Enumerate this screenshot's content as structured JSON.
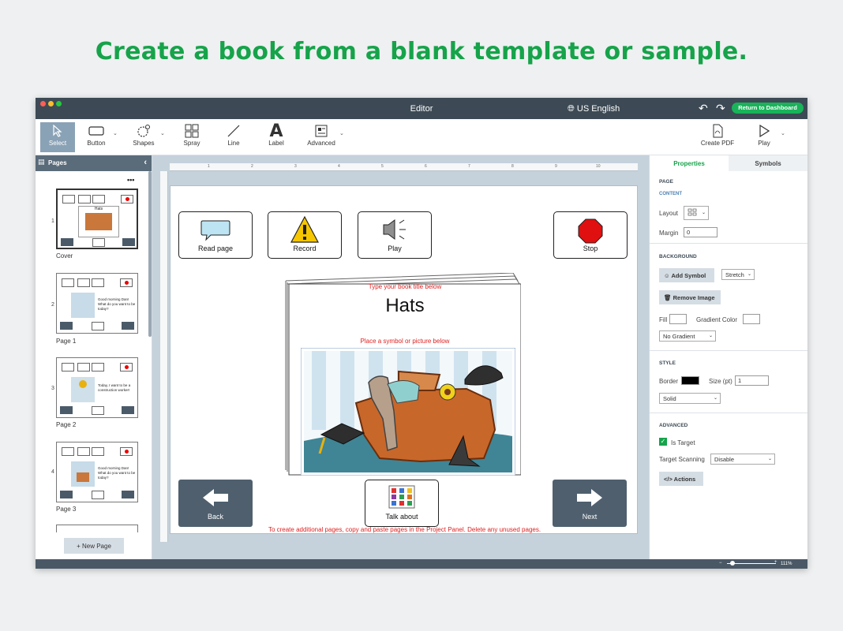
{
  "headline": "Create a book from a blank template or sample.",
  "colors": {
    "accent": "#16a34a",
    "titlebar": "#3d4a55",
    "dash_button": "#19b35a"
  },
  "window": {
    "title": "Editor",
    "language": "US English",
    "return_button": "Return to Dashboard"
  },
  "toolbar": {
    "select": "Select",
    "button": "Button",
    "shapes": "Shapes",
    "spray": "Spray",
    "line": "Line",
    "label": "Label",
    "label_glyph": "A",
    "advanced": "Advanced",
    "create_pdf": "Create PDF",
    "play": "Play"
  },
  "pages_panel": {
    "title": "Pages",
    "menu": "•••",
    "thumbs": [
      {
        "num": "1",
        "label": "Cover",
        "title": "Hats"
      },
      {
        "num": "2",
        "label": "Page 1",
        "text": "Good morning Dan! What do you want to be today?"
      },
      {
        "num": "3",
        "label": "Page 2",
        "text": "Today, I want to be a construction worker!"
      },
      {
        "num": "4",
        "label": "Page 3",
        "text": "Good morning Dan! What do you want to be today?"
      }
    ],
    "new_page": "+ New Page"
  },
  "canvas": {
    "ruler": [
      "1",
      "2",
      "3",
      "4",
      "5",
      "6",
      "7",
      "8",
      "9",
      "10"
    ],
    "buttons": {
      "read_page": "Read page",
      "record": "Record",
      "play": "Play",
      "stop": "Stop",
      "back": "Back",
      "next": "Next",
      "talk_about": "Talk about"
    },
    "book_title_hint": "Type your book title below",
    "book_title": "Hats",
    "picture_hint": "Place a symbol or picture below",
    "bottom_hint": "To create additional pages, copy and paste pages in the Project Panel. Delete any unused pages."
  },
  "properties": {
    "tab_properties": "Properties",
    "tab_symbols": "Symbols",
    "page_title": "PAGE",
    "content_title": "CONTENT",
    "layout_label": "Layout",
    "margin_label": "Margin",
    "margin_value": "0",
    "background_title": "BACKGROUND",
    "add_symbol": "Add Symbol",
    "stretch": "Stretch",
    "remove_image": "Remove Image",
    "fill_label": "Fill",
    "gradient_color_label": "Gradient Color",
    "gradient_select": "No Gradient",
    "style_title": "STYLE",
    "border_label": "Border",
    "size_label": "Size (pt)",
    "size_value": "1",
    "line_style": "Solid",
    "advanced_title": "ADVANCED",
    "is_target": "Is Target",
    "target_scanning_label": "Target Scanning",
    "target_scanning_value": "Disable",
    "actions": "Actions"
  },
  "status": {
    "zoom": "111%"
  }
}
